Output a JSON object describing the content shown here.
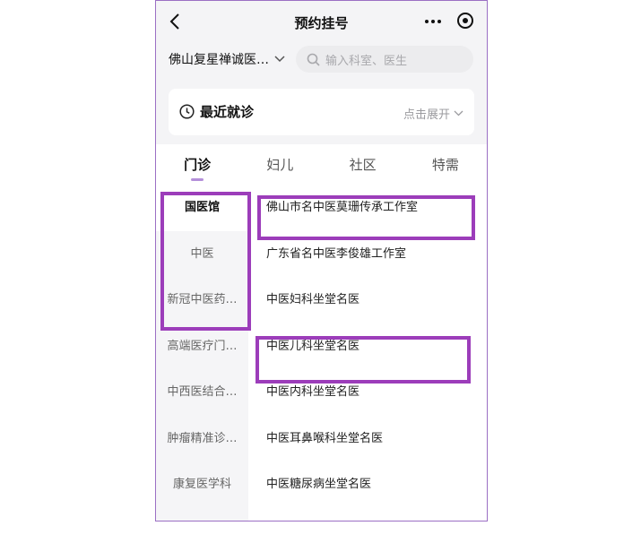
{
  "navbar": {
    "title": "预约挂号",
    "back_icon": "chevron-left-icon",
    "more_icon": "more-horizontal-icon",
    "close_icon": "target-close-icon"
  },
  "hospital": {
    "name": "佛山复星禅诚医…",
    "dropdown_icon": "chevron-down-icon"
  },
  "search": {
    "placeholder": "输入科室、医生",
    "icon": "search-icon"
  },
  "recent_visits": {
    "title": "最近就诊",
    "expand_label": "点击展开",
    "icon": "clock-icon"
  },
  "tabs": [
    {
      "label": "门诊",
      "active": true
    },
    {
      "label": "妇儿",
      "active": false
    },
    {
      "label": "社区",
      "active": false
    },
    {
      "label": "特需",
      "active": false
    }
  ],
  "departments": [
    {
      "label": "国医馆",
      "active": true
    },
    {
      "label": "中医",
      "active": false
    },
    {
      "label": "新冠中医药…",
      "active": false
    },
    {
      "label": "高端医疗门…",
      "active": false
    },
    {
      "label": "中西医结合…",
      "active": false
    },
    {
      "label": "肿瘤精准诊…",
      "active": false
    },
    {
      "label": "康复医学科",
      "active": false
    }
  ],
  "clinics": [
    "佛山市名中医莫珊传承工作室",
    "广东省名中医李俊雄工作室",
    "中医妇科坐堂名医",
    "中医儿科坐堂名医",
    "中医内科坐堂名医",
    "中医耳鼻喉科坐堂名医",
    "中医糖尿病坐堂名医"
  ],
  "colors": {
    "accent": "#b48fd9",
    "annotation": "#9c3dba",
    "frame": "#9b6fc4"
  }
}
